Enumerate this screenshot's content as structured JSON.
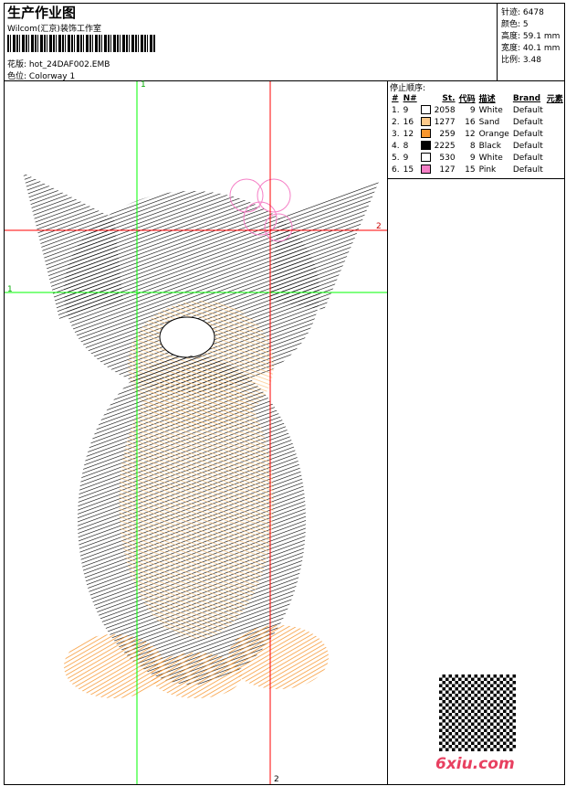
{
  "header": {
    "title": "生产作业图",
    "studio": "Wilcom(汇京)装饰工作室",
    "pattern_label": "花版:",
    "pattern_value": "hot_24DAF002.EMB",
    "colorway_label": "色位:",
    "colorway_value": "Colorway 1"
  },
  "stats": [
    {
      "label": "针迹:",
      "value": "6478"
    },
    {
      "label": "颜色:",
      "value": "5"
    },
    {
      "label": "高度:",
      "value": "59.1 mm"
    },
    {
      "label": "宽度:",
      "value": "40.1 mm"
    },
    {
      "label": "比例:",
      "value": "3.48"
    }
  ],
  "stop_sequence": {
    "title": "停止顺序:",
    "columns": [
      "#",
      "N#",
      "St.",
      "代码",
      "描述",
      "Brand",
      "元素"
    ],
    "rows": [
      {
        "idx": "1.",
        "n": "9",
        "color": "#ffffff",
        "st": "2058",
        "code": "9",
        "desc": "White",
        "brand": "Default"
      },
      {
        "idx": "2.",
        "n": "16",
        "color": "#fcc98a",
        "st": "1277",
        "code": "16",
        "desc": "Sand",
        "brand": "Default"
      },
      {
        "idx": "3.",
        "n": "12",
        "color": "#f7962e",
        "st": "259",
        "code": "12",
        "desc": "Orange",
        "brand": "Default"
      },
      {
        "idx": "4.",
        "n": "8",
        "color": "#000000",
        "st": "2225",
        "code": "8",
        "desc": "Black",
        "brand": "Default"
      },
      {
        "idx": "5.",
        "n": "9",
        "color": "#ffffff",
        "st": "530",
        "code": "9",
        "desc": "White",
        "brand": "Default"
      },
      {
        "idx": "6.",
        "n": "15",
        "color": "#f57fc6",
        "st": "127",
        "code": "15",
        "desc": "Pink",
        "brand": "Default"
      }
    ]
  },
  "markers": {
    "green": "1",
    "red": "2"
  },
  "watermark": "6xiu.com"
}
